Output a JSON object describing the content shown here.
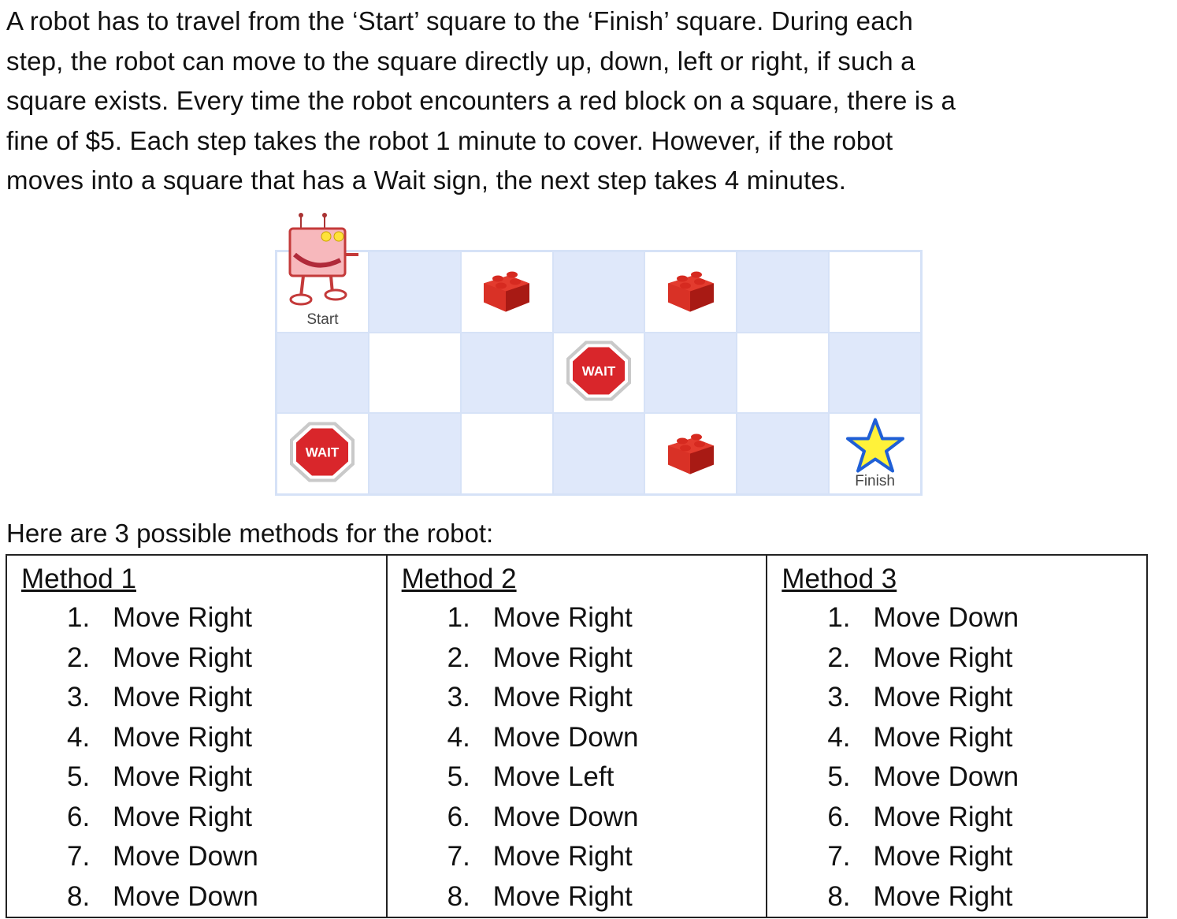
{
  "intro": {
    "lines": [
      "A robot has to travel from the ‘Start’ square to the ‘Finish’ square. During each",
      "step, the robot can move to the square directly up, down, left or right, if such a",
      "square exists. Every time the robot encounters a red block on a square, there is a",
      "fine of $5. Each step takes the robot 1 minute to cover. However, if the robot",
      "moves into a square that has a Wait sign, the next step takes 4 minutes."
    ]
  },
  "board": {
    "rows": 3,
    "cols": 7,
    "start_label": "Start",
    "finish_label": "Finish",
    "wait_label": "WAIT",
    "cells": [
      [
        "robot-start",
        "empty",
        "red-block",
        "empty",
        "red-block",
        "empty",
        "empty"
      ],
      [
        "empty",
        "empty",
        "empty",
        "wait-sign",
        "empty",
        "empty",
        "empty"
      ],
      [
        "wait-sign",
        "empty",
        "empty",
        "empty",
        "red-block",
        "empty",
        "finish-star"
      ]
    ],
    "colors": {
      "blue_cell": "#dfe8fa",
      "white_cell": "#ffffff",
      "block": "#d42a1e",
      "stop": "#d9262b",
      "star_fill": "#fff23a",
      "star_stroke": "#1f5fd6"
    }
  },
  "caption": "Here are 3 possible methods for the robot:",
  "methods": [
    {
      "title": "Method 1",
      "steps": [
        "Move Right",
        "Move Right",
        "Move Right",
        "Move Right",
        "Move Right",
        "Move Right",
        "Move Down",
        "Move Down"
      ]
    },
    {
      "title": "Method 2",
      "steps": [
        "Move Right",
        "Move Right",
        "Move Right",
        "Move Down",
        "Move Left",
        "Move Down",
        "Move Right",
        "Move Right"
      ]
    },
    {
      "title": "Method 3",
      "steps": [
        "Move Down",
        "Move Right",
        "Move Right",
        "Move Right",
        "Move Down",
        "Move Right",
        "Move Right",
        "Move Right"
      ]
    }
  ]
}
